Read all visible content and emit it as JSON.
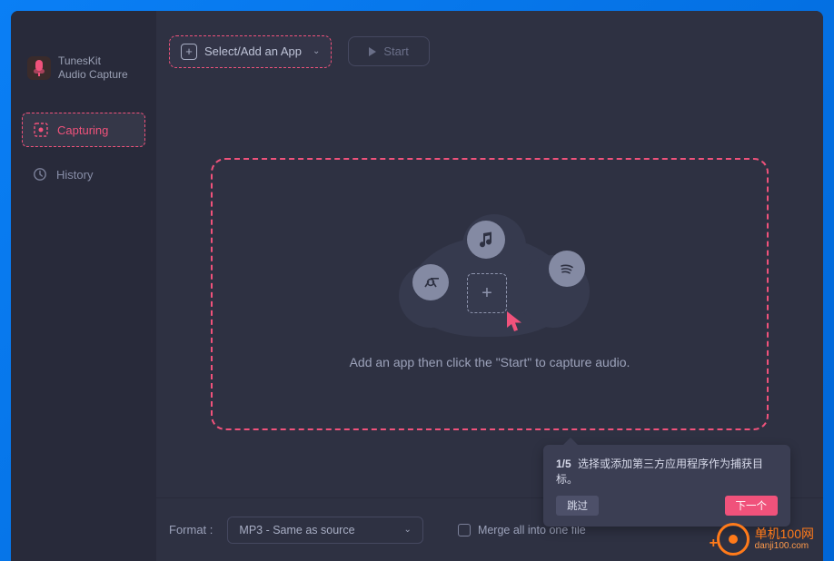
{
  "app": {
    "name_line1": "TunesKit",
    "name_line2": "Audio Capture"
  },
  "sidebar": {
    "items": [
      {
        "label": "Capturing",
        "icon": "capture-icon",
        "active": true
      },
      {
        "label": "History",
        "icon": "history-icon",
        "active": false
      }
    ]
  },
  "topbar": {
    "select_app_label": "Select/Add an App",
    "start_label": "Start"
  },
  "dropzone": {
    "hint": "Add an app then click the \"Start\" to capture audio."
  },
  "tooltip": {
    "step": "1/5",
    "text": "选择或添加第三方应用程序作为捕获目标。",
    "skip": "跳过",
    "next": "下一个"
  },
  "bottombar": {
    "format_label": "Format :",
    "format_value": "MP3 - Same as source",
    "merge_label": "Merge all into one file"
  },
  "watermark": {
    "title": "单机100网",
    "sub": "danji100.com"
  }
}
